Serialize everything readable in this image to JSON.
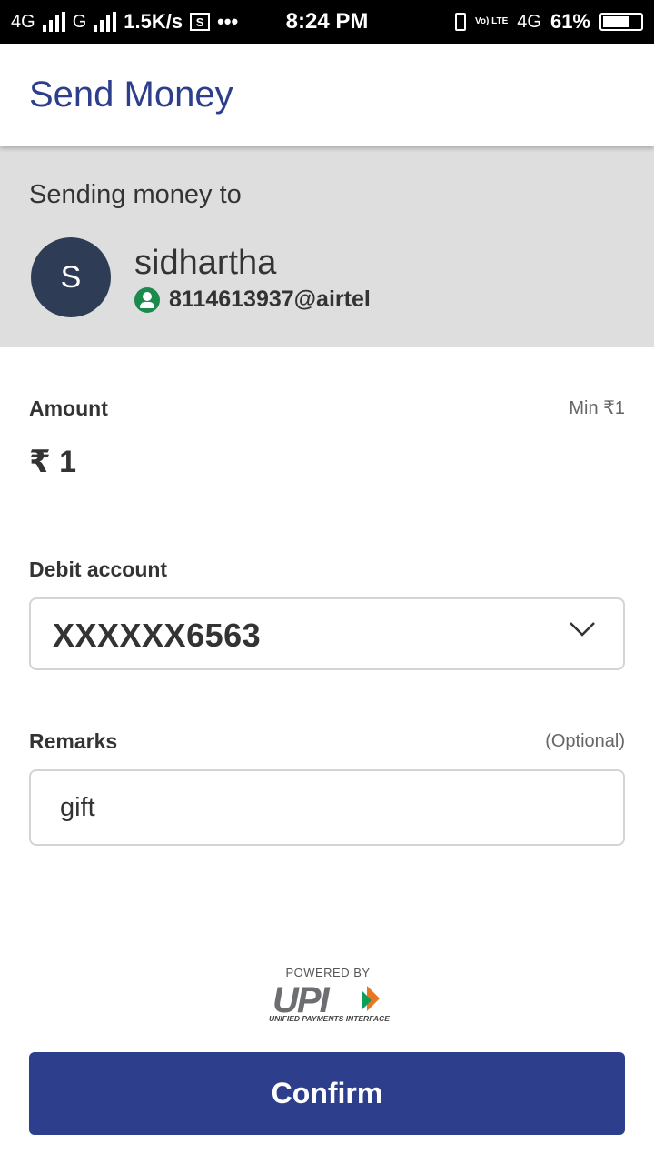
{
  "status_bar": {
    "network1": "4G",
    "network2": "G",
    "speed": "1.5K/s",
    "screenshot_glyph": "S",
    "more": "•••",
    "time": "8:24 PM",
    "volte": "Vo) LTE",
    "network3": "4G",
    "battery": "61%",
    "battery_level": 0.61
  },
  "app_bar": {
    "title": "Send Money"
  },
  "recipient": {
    "caption": "Sending money to",
    "avatar_initial": "S",
    "name": "sidhartha",
    "vpa_icon": "user-verified-icon",
    "vpa": "8114613937@airtel"
  },
  "amount": {
    "label": "Amount",
    "min_hint": "Min ₹1",
    "value": "₹ 1"
  },
  "debit_account": {
    "label": "Debit account",
    "selected": "XXXXXX6563",
    "dropdown_icon": "chevron-down-icon"
  },
  "remarks": {
    "label": "Remarks",
    "optional_hint": "(Optional)",
    "value": "gift"
  },
  "footer": {
    "powered_by": "POWERED BY",
    "upi_mark": "UPI",
    "upi_subtitle": "UNIFIED PAYMENTS INTERFACE"
  },
  "confirm_label": "Confirm",
  "colors": {
    "primary": "#2c3e8c",
    "recipient_bg": "#dedede",
    "avatar_bg": "#2e3d55",
    "verified_green": "#1b8a4c"
  }
}
